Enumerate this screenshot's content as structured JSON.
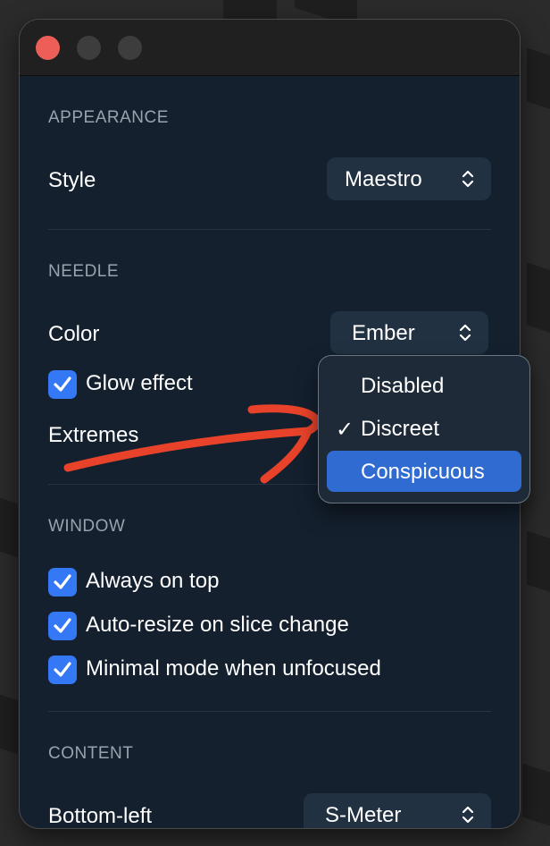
{
  "window": {
    "traffic_lights": {
      "close_color": "#ee5e58",
      "inactive_color": "#3d3d3d"
    }
  },
  "sections": {
    "appearance": {
      "title": "APPEARANCE",
      "style": {
        "label": "Style",
        "value": "Maestro"
      }
    },
    "needle": {
      "title": "NEEDLE",
      "color": {
        "label": "Color",
        "value": "Ember"
      },
      "glow_effect": {
        "label": "Glow effect",
        "checked": true
      },
      "extremes": {
        "label": "Extremes"
      }
    },
    "window": {
      "title": "WINDOW",
      "always_on_top": {
        "label": "Always on top",
        "checked": true
      },
      "auto_resize": {
        "label": "Auto-resize on slice change",
        "checked": true
      },
      "minimal_mode": {
        "label": "Minimal mode when unfocused",
        "checked": true
      }
    },
    "content": {
      "title": "CONTENT",
      "bottom_left": {
        "label": "Bottom-left",
        "value": "S-Meter"
      }
    }
  },
  "extremes_menu": {
    "items": [
      {
        "label": "Disabled",
        "checked": false,
        "highlighted": false
      },
      {
        "label": "Discreet",
        "checked": true,
        "highlighted": false
      },
      {
        "label": "Conspicuous",
        "checked": false,
        "highlighted": true
      }
    ],
    "check_glyph": "✓"
  },
  "colors": {
    "window_bg": "#14202e",
    "accent": "#3478f6",
    "menu_highlight": "#2f6bd1",
    "annotation_stroke": "#e8432a"
  },
  "annotation": {
    "type": "hand-drawn-arrow-stroke",
    "color": "#e8432a"
  }
}
